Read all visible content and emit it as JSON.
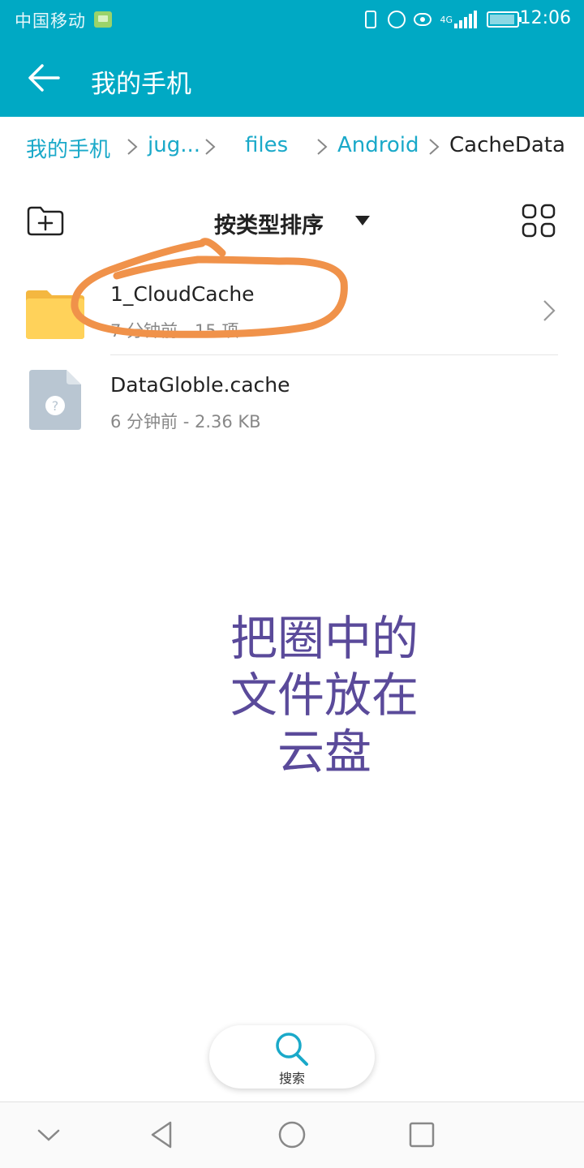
{
  "status_bar": {
    "carrier": "中国移动",
    "network": "4G",
    "time": "12:06"
  },
  "header": {
    "title": "我的手机"
  },
  "breadcrumb": [
    {
      "label": "我的手机"
    },
    {
      "label": "jug..."
    },
    {
      "label": "files"
    },
    {
      "label": "Android"
    },
    {
      "label": "CacheData"
    }
  ],
  "toolbar": {
    "sort_label": "按类型排序"
  },
  "files": [
    {
      "name": "1_CloudCache",
      "meta": "7 分钟前 - 15 项",
      "type": "folder-icon"
    },
    {
      "name": "DataGloble.cache",
      "meta": "6 分钟前 - 2.36 KB",
      "type": "unknown-file-icon"
    }
  ],
  "annotation": {
    "lines": [
      "把圈中的",
      "文件放在",
      "云盘"
    ],
    "circle_color": "#f0924a",
    "text_color": "#5a4a9a"
  },
  "search": {
    "label": "搜索"
  },
  "colors": {
    "accent": "#00a9c4",
    "link": "#1aa9c9",
    "folder": "#ffd25a"
  }
}
